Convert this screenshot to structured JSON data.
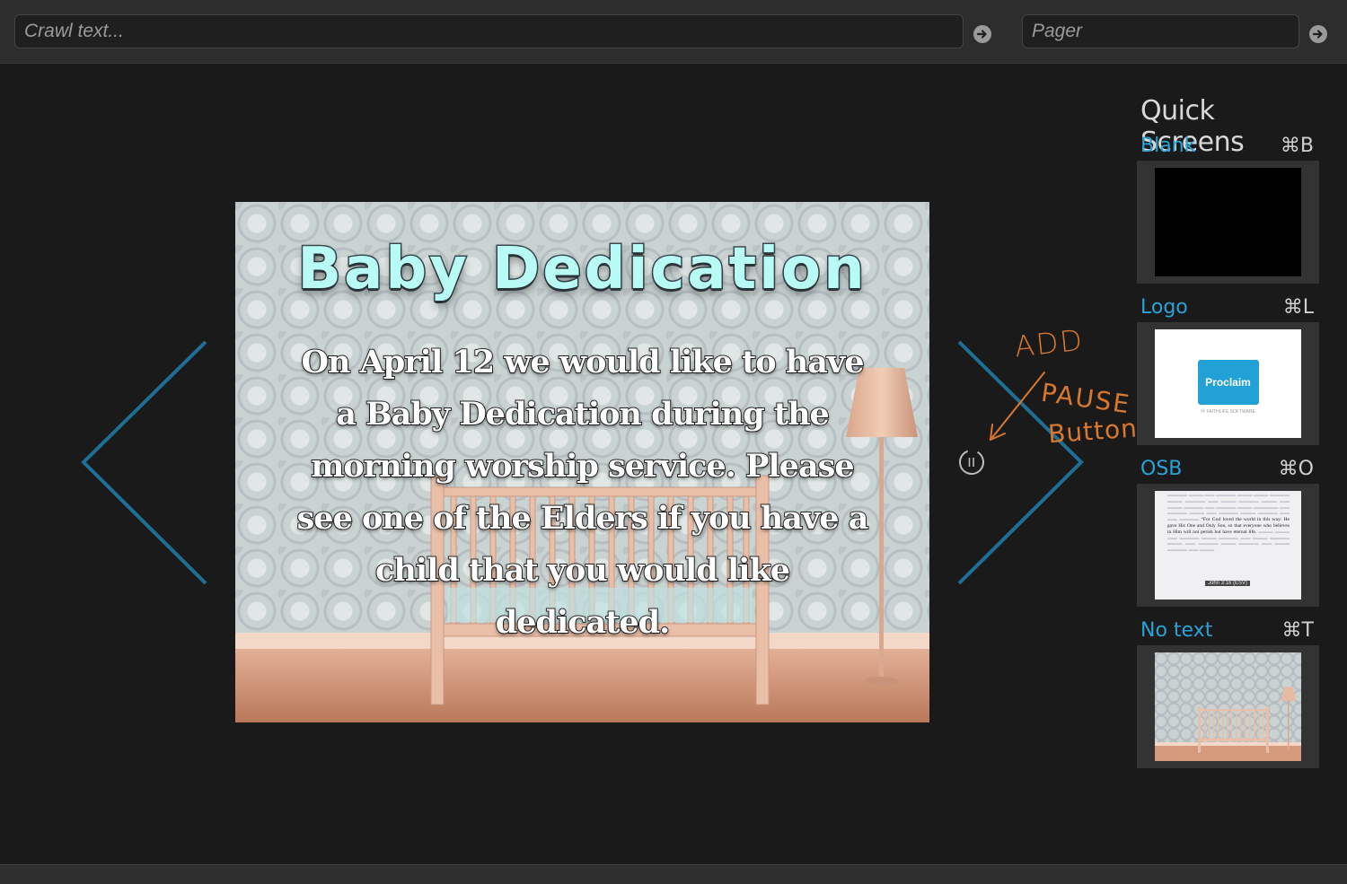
{
  "topbar": {
    "crawl_placeholder": "Crawl text...",
    "pager_placeholder": "Pager"
  },
  "slide": {
    "title": "Baby Dedication",
    "lines": [
      "On April 12 we would like to have",
      "a Baby Dedication during the",
      "morning worship service.  Please",
      "see one of the Elders if you have a",
      "child that you would like",
      "dedicated."
    ]
  },
  "annotation": {
    "lines": [
      "ADD",
      "PAUSE",
      "Button"
    ],
    "color": "#d8782e"
  },
  "quick_screens": {
    "title": "Quick Screens",
    "items": [
      {
        "label": "Blank",
        "shortcut": "⌘B"
      },
      {
        "label": "Logo",
        "shortcut": "⌘L",
        "logo_text": "Proclaim",
        "logo_sub": "Ⓜ FAITHLIFE SOFTWARE"
      },
      {
        "label": "OSB",
        "shortcut": "⌘O",
        "verse_ref": "John 3:16 (ESV)",
        "verse_text": "“For God loved the world in this way: He gave His One and Only Son, so that everyone who believes in Him will not perish but have eternal life."
      },
      {
        "label": "No text",
        "shortcut": "⌘T"
      }
    ]
  },
  "colors": {
    "accent": "#29a3d6",
    "nav_chevron": "#1e6f96",
    "background": "#1a1a1a"
  }
}
